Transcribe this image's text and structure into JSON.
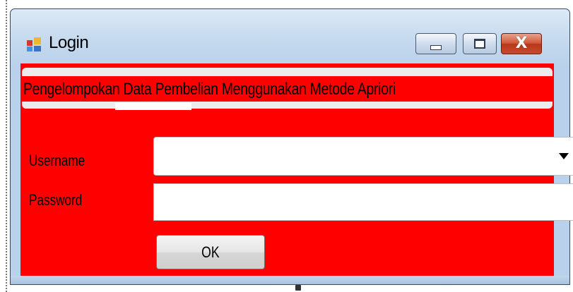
{
  "window": {
    "title": "Login",
    "icon": "windows-form-icon",
    "controls": {
      "minimize_icon": "minimize-icon",
      "maximize_icon": "maximize-icon",
      "close_label": "X"
    }
  },
  "header": {
    "title": "Pengelompokan Data Pembelian Menggunakan Metode Apriori"
  },
  "form": {
    "username_label": "Username",
    "username_value": "",
    "password_label": "Password",
    "password_value": "",
    "ok_label": "OK"
  },
  "colors": {
    "client_background": "#ff0000",
    "title_bar": "#c7dbef",
    "close_button": "#c94a2a"
  }
}
